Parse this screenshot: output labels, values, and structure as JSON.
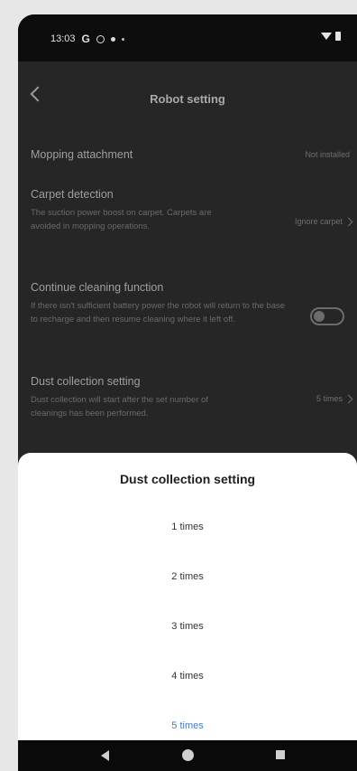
{
  "status_bar": {
    "time": "13:03",
    "icons": [
      "google-icon",
      "target-icon",
      "dot-icon",
      "small-dot-icon",
      "wifi-icon",
      "battery-icon"
    ]
  },
  "header": {
    "title": "Robot setting",
    "back_icon": "chevron-left-icon"
  },
  "settings": [
    {
      "title": "Mopping attachment",
      "value": "Not installed"
    },
    {
      "title": "Carpet detection",
      "description": "The suction power boost on carpet. Carpets are avoided in mopping operations.",
      "value": "Ignore carpet"
    },
    {
      "title": "Continue cleaning function",
      "description": "If there isn't sufficient battery power the robot will return to the base to recharge and then resume cleaning where it left off.",
      "toggle": "off"
    },
    {
      "title": "Dust collection setting",
      "description": "Dust collection will start after the set number of cleanings has been performed.",
      "value": "5 times"
    }
  ],
  "sheet": {
    "title": "Dust collection setting",
    "options": [
      "1 times",
      "2 times",
      "3 times",
      "4 times",
      "5 times"
    ],
    "selected": "5 times",
    "accent_color": "#3d7be0"
  },
  "nav_bar": {
    "icons": [
      "back-triangle-icon",
      "home-circle-icon",
      "recents-square-icon"
    ]
  }
}
